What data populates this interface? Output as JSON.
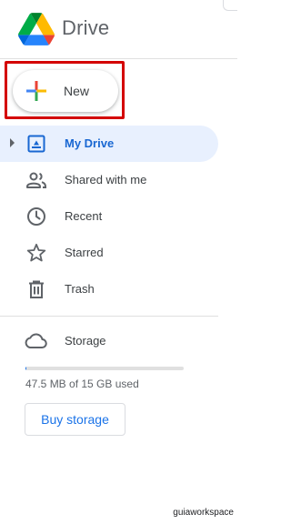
{
  "app": {
    "brand": "Drive",
    "logo_icon": "google-drive-logo"
  },
  "new_button": {
    "label": "New",
    "icon": "plus-icon",
    "highlight_color": "#d40000"
  },
  "nav": {
    "items": [
      {
        "label": "My Drive",
        "icon": "my-drive-icon",
        "active": true
      },
      {
        "label": "Shared with me",
        "icon": "people-icon",
        "active": false
      },
      {
        "label": "Recent",
        "icon": "clock-icon",
        "active": false
      },
      {
        "label": "Starred",
        "icon": "star-icon",
        "active": false
      },
      {
        "label": "Trash",
        "icon": "trash-icon",
        "active": false
      }
    ]
  },
  "storage": {
    "label": "Storage",
    "icon": "cloud-icon",
    "usage_text": "47.5 MB of 15 GB used",
    "used_fraction": 0.003,
    "buy_label": "Buy storage"
  },
  "watermark": "guiaworkspace",
  "colors": {
    "accent": "#1a73e8",
    "active_bg": "#e8f0fe",
    "active_text": "#1967d2"
  }
}
